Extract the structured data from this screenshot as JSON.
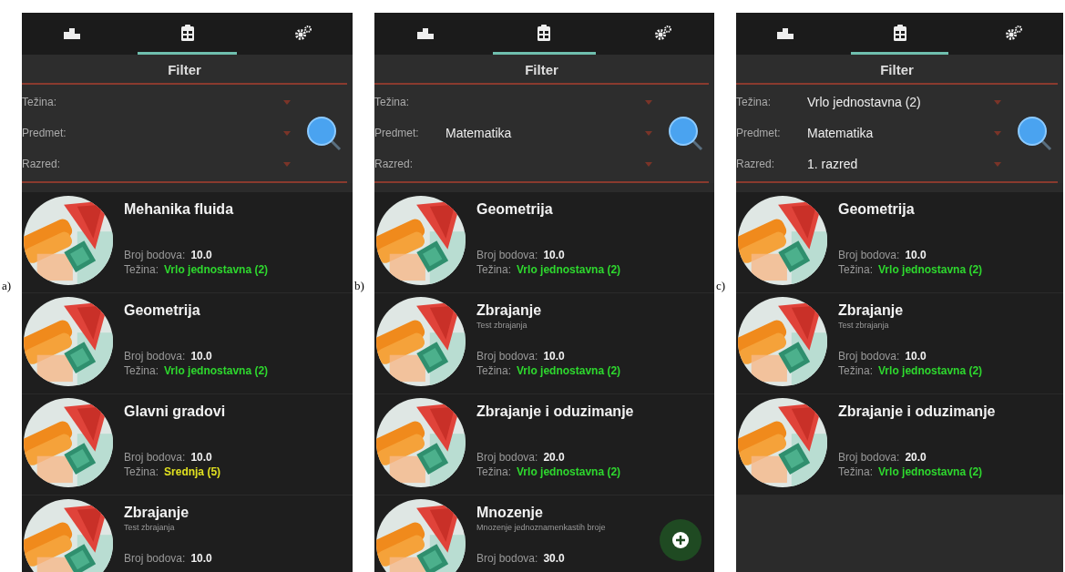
{
  "panels": [
    {
      "caption": "a)",
      "tabs": [
        {
          "selected": false
        },
        {
          "selected": true
        },
        {
          "selected": false
        }
      ],
      "filter": {
        "title": "Filter",
        "fields": [
          {
            "label": "Težina:"
          },
          {
            "label": "Predmet:"
          },
          {
            "label": "Razred:"
          }
        ]
      },
      "items": [
        {
          "title": "Mehanika fluida",
          "points_label": "Broj bodova:",
          "points": "10.0",
          "difficulty_label": "Težina:",
          "difficulty": "Vrlo jednostavna (2)",
          "color": "#2ed82e"
        },
        {
          "title": "Geometrija",
          "points_label": "Broj bodova:",
          "points": "10.0",
          "difficulty_label": "Težina:",
          "difficulty": "Vrlo jednostavna (2)",
          "color": "#2ed82e"
        },
        {
          "title": "Glavni gradovi",
          "points_label": "Broj bodova:",
          "points": "10.0",
          "difficulty_label": "Težina:",
          "difficulty": "Srednja (5)",
          "color": "#e0e020"
        },
        {
          "title": "Zbrajanje",
          "subtitle": "Test zbrajanja",
          "points_label": "Broj bodova:",
          "points": "10.0"
        }
      ],
      "add_button": false
    },
    {
      "caption": "b)",
      "tabs": [
        {
          "selected": false
        },
        {
          "selected": true
        },
        {
          "selected": false
        }
      ],
      "filter": {
        "title": "Filter",
        "fields": [
          {
            "label": "Težina:"
          },
          {
            "label": "Predmet:",
            "value": "Matematika"
          },
          {
            "label": "Razred:"
          }
        ]
      },
      "items": [
        {
          "title": "Geometrija",
          "points_label": "Broj bodova:",
          "points": "10.0",
          "difficulty_label": "Težina:",
          "difficulty": "Vrlo jednostavna (2)",
          "color": "#2ed82e"
        },
        {
          "title": "Zbrajanje",
          "subtitle": "Test zbrajanja",
          "points_label": "Broj bodova:",
          "points": "10.0",
          "difficulty_label": "Težina:",
          "difficulty": "Vrlo jednostavna (2)",
          "color": "#2ed82e"
        },
        {
          "title": "Zbrajanje i oduzimanje",
          "points_label": "Broj bodova:",
          "points": "20.0",
          "difficulty_label": "Težina:",
          "difficulty": "Vrlo jednostavna (2)",
          "color": "#2ed82e"
        },
        {
          "title": "Mnozenje",
          "subtitle": "Mnozenje jednoznamenkastih broje",
          "points_label": "Broj bodova:",
          "points": "30.0"
        }
      ],
      "add_button": true
    },
    {
      "caption": "c)",
      "tabs": [
        {
          "selected": false
        },
        {
          "selected": true
        },
        {
          "selected": false
        }
      ],
      "filter": {
        "title": "Filter",
        "fields": [
          {
            "label": "Težina:",
            "value": "Vrlo jednostavna (2)"
          },
          {
            "label": "Predmet:",
            "value": "Matematika"
          },
          {
            "label": "Razred:",
            "value": "1. razred"
          }
        ]
      },
      "items": [
        {
          "title": "Geometrija",
          "points_label": "Broj bodova:",
          "points": "10.0",
          "difficulty_label": "Težina:",
          "difficulty": "Vrlo jednostavna (2)",
          "color": "#2ed82e"
        },
        {
          "title": "Zbrajanje",
          "subtitle": "Test zbrajanja",
          "points_label": "Broj bodova:",
          "points": "10.0",
          "difficulty_label": "Težina:",
          "difficulty": "Vrlo jednostavna (2)",
          "color": "#2ed82e"
        },
        {
          "title": "Zbrajanje i oduzimanje",
          "points_label": "Broj bodova:",
          "points": "20.0",
          "difficulty_label": "Težina:",
          "difficulty": "Vrlo jednostavna (2)",
          "color": "#2ed82e"
        }
      ],
      "add_button": false
    }
  ]
}
